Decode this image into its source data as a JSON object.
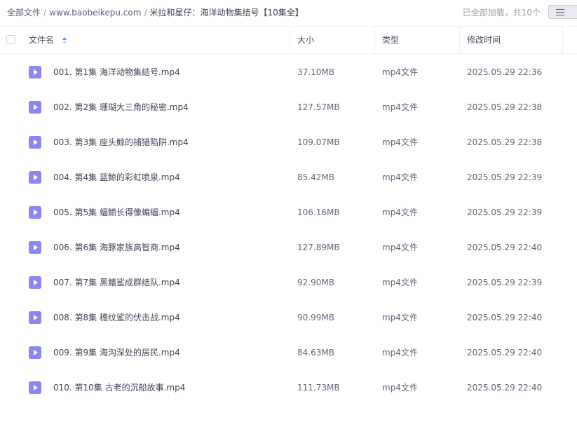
{
  "breadcrumb": {
    "root": "全部文件",
    "site": "www.baobeikepu.com",
    "current": "米拉和星仔：海洋动物集结号【10集全】",
    "separator": "/"
  },
  "status": {
    "loaded_text": "已全部加载，共10个"
  },
  "header": {
    "name": "文件名",
    "size": "大小",
    "type": "类型",
    "modified": "修改时间"
  },
  "colors": {
    "file_icon": "#8c86f2",
    "sort_active": "#3b9cf6"
  },
  "icons": {
    "file": "video-file-icon",
    "sort": "sort-icon",
    "view": "list-view-icon"
  },
  "files": [
    {
      "name": "001. 第1集 海洋动物集结号.mp4",
      "size": "37.10MB",
      "type": "mp4文件",
      "modified": "2025.05.29 22:36"
    },
    {
      "name": "002. 第2集 珊瑚大三角的秘密.mp4",
      "size": "127.57MB",
      "type": "mp4文件",
      "modified": "2025.05.29 22:38"
    },
    {
      "name": "003. 第3集 座头鲸的捕猎陷阱.mp4",
      "size": "109.07MB",
      "type": "mp4文件",
      "modified": "2025.05.29 22:38"
    },
    {
      "name": "004. 第4集 蓝鲸的彩虹喷泉.mp4",
      "size": "85.42MB",
      "type": "mp4文件",
      "modified": "2025.05.29 22:39"
    },
    {
      "name": "005. 第5集 蝠鲼长得像蝙蝠.mp4",
      "size": "106.16MB",
      "type": "mp4文件",
      "modified": "2025.05.29 22:39"
    },
    {
      "name": "006. 第6集 海豚家族高智商.mp4",
      "size": "127.89MB",
      "type": "mp4文件",
      "modified": "2025.05.29 22:40"
    },
    {
      "name": "007. 第7集 黑鳍鲨成群结队.mp4",
      "size": "92.90MB",
      "type": "mp4文件",
      "modified": "2025.05.29 22:39"
    },
    {
      "name": "008. 第8集 穗纹鲨的伏击战.mp4",
      "size": "90.99MB",
      "type": "mp4文件",
      "modified": "2025.05.29 22:40"
    },
    {
      "name": "009. 第9集 海沟深处的居民.mp4",
      "size": "84.63MB",
      "type": "mp4文件",
      "modified": "2025.05.29 22:40"
    },
    {
      "name": "010. 第10集 古老的沉船故事.mp4",
      "size": "111.73MB",
      "type": "mp4文件",
      "modified": "2025.05.29 22:40"
    }
  ]
}
